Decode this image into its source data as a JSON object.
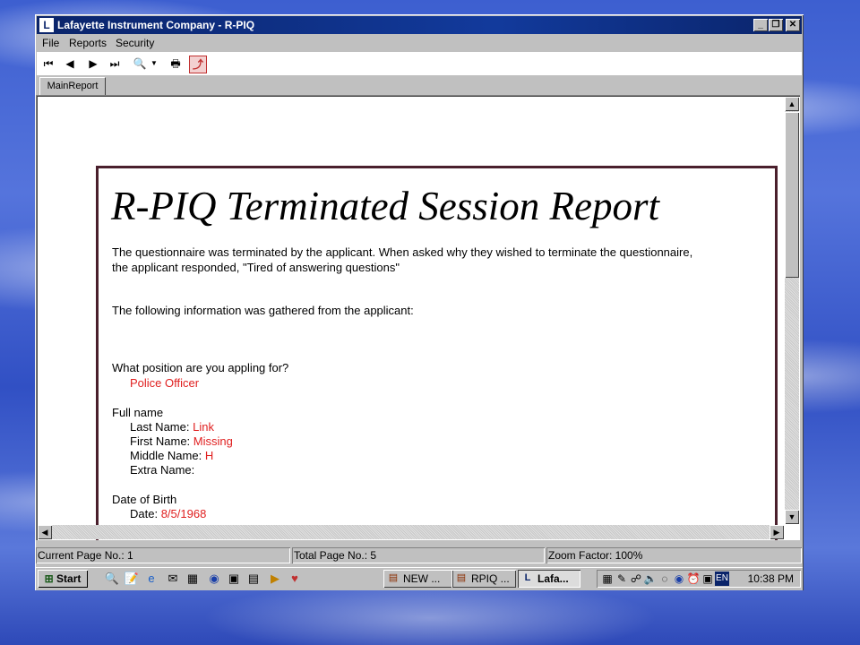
{
  "window": {
    "title": "Lafayette Instrument Company - R-PIQ",
    "app_icon": "L"
  },
  "menu": {
    "items": [
      "File",
      "Reports",
      "Security"
    ]
  },
  "toolbar": {
    "icons": [
      "first-page-icon",
      "previous-page-icon",
      "next-page-icon",
      "last-page-icon",
      "zoom-icon",
      "dropdown-arrow-icon",
      "print-icon",
      "export-icon"
    ]
  },
  "tabs": [
    {
      "label": "MainReport"
    }
  ],
  "report": {
    "title": "R-PIQ Terminated Session Report",
    "termination_line1": "The questionnaire was terminated by the applicant. When asked why they wished to terminate the questionnaire,",
    "termination_line2": "the applicant responded, \"Tired of answering questions\"",
    "info_intro": "The following information was gathered from the applicant:",
    "position_question": "What position are you appling for?",
    "position_answer": "Police Officer",
    "full_name_label": "Full name",
    "last_name_label": "Last Name:",
    "last_name_value": "Link",
    "first_name_label": "First Name:",
    "first_name_value": "Missing",
    "middle_name_label": "Middle Name:",
    "middle_name_value": "H",
    "extra_name_label": "Extra Name:",
    "dob_label": "Date of Birth",
    "date_label": "Date:",
    "date_value": "8/5/1968"
  },
  "status": {
    "current_page": "Current Page No.: 1",
    "total_pages": "Total Page No.: 5",
    "zoom": "Zoom Factor: 100%"
  },
  "taskbar": {
    "start_label": "Start",
    "tasks": [
      {
        "label": "NEW ...",
        "active": false
      },
      {
        "label": "RPIQ ...",
        "active": false
      },
      {
        "label": "Lafa...",
        "active": true
      }
    ],
    "tray_lang": "EN",
    "clock": "10:38 PM"
  },
  "colors": {
    "accent_red": "#e02020",
    "report_border": "#4a1f2c",
    "title_bar": "#0a246a"
  }
}
